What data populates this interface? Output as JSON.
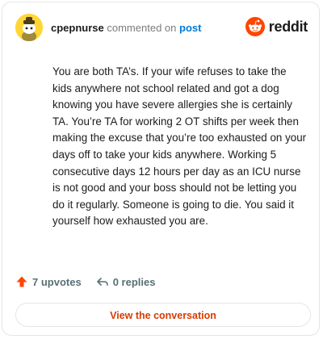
{
  "comment": {
    "username": "cpepnurse",
    "commented_on": "commented on",
    "post_link": "post",
    "body": "You are both TA’s. If your wife refuses to take the kids anywhere not school related and got a dog knowing you have severe allergies she is certainly TA. You’re TA for working 2 OT shifts per week then making the excuse that you’re too exhausted on your days off to take your kids anywhere. Working 5 consecutive days 12 hours per day as an ICU nurse is not good and your boss should not be letting you do it regularly. Someone is going to die. You said it yourself how exhausted you are."
  },
  "brand": {
    "name": "reddit",
    "color": "#ff4500"
  },
  "actions": {
    "upvotes": "7 upvotes",
    "replies": "0 replies"
  },
  "cta": {
    "label": "View the conversation"
  },
  "colors": {
    "accent": "#d93a00",
    "upvote": "#ff4500",
    "link": "#0079d3",
    "avatar_bg": "#ffd635"
  },
  "icons": {
    "avatar": "snoo-avatar-icon",
    "brand": "reddit-logo-icon",
    "upvote": "upvote-arrow-icon",
    "reply": "reply-arrow-icon"
  }
}
